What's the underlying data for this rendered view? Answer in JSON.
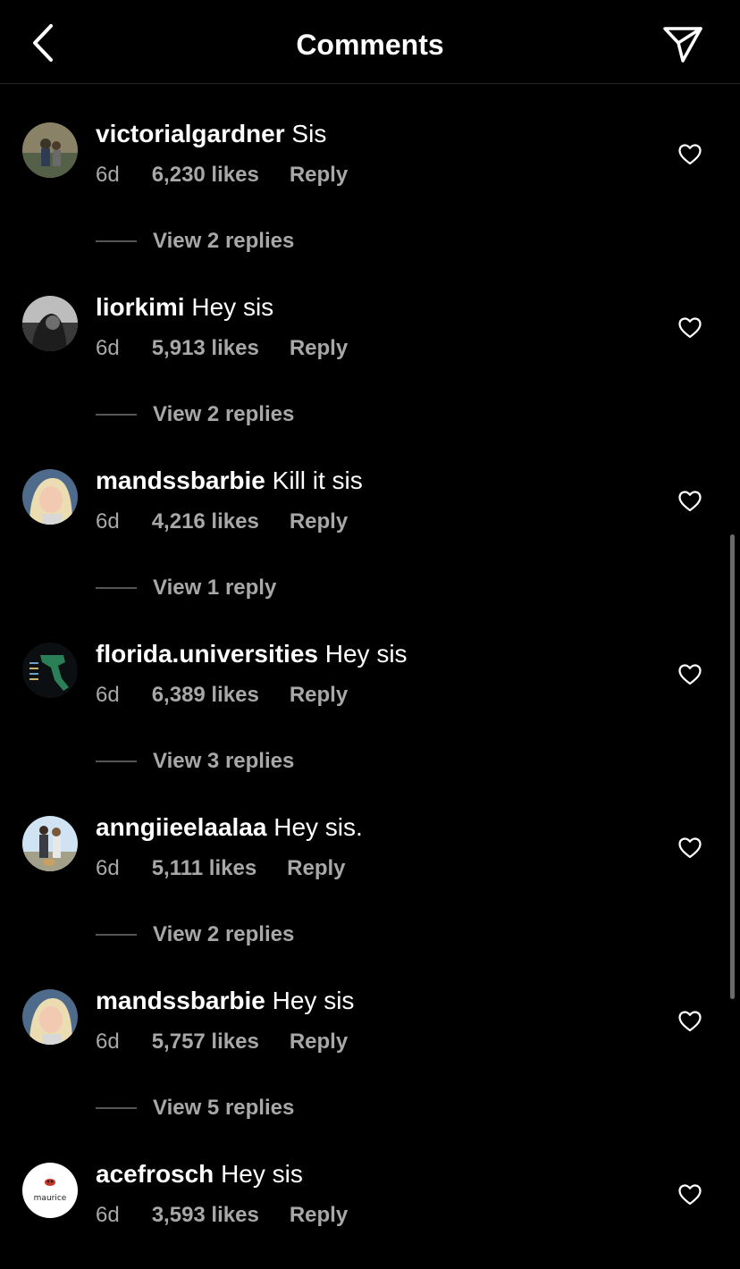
{
  "header": {
    "title": "Comments",
    "back_icon": "chevron-left-icon",
    "share_icon": "paper-plane-icon"
  },
  "comments": [
    {
      "username": "victorialgardner",
      "text": "Sis",
      "time": "6d",
      "likes": "6,230 likes",
      "reply": "Reply",
      "view_replies": "View 2 replies",
      "avatar_colors": [
        "#6e6a52",
        "#3f4a3a"
      ]
    },
    {
      "username": "liorkimi",
      "text": "Hey sis",
      "time": "6d",
      "likes": "5,913 likes",
      "reply": "Reply",
      "view_replies": "View 2 replies",
      "avatar_colors": [
        "#d8d8d8",
        "#2a2a2a"
      ]
    },
    {
      "username": "mandssbarbie",
      "text": "Kill it sis",
      "time": "6d",
      "likes": "4,216 likes",
      "reply": "Reply",
      "view_replies": "View 1 reply",
      "avatar_colors": [
        "#e9d9b8",
        "#5b6f86"
      ]
    },
    {
      "username": "florida.universities",
      "text": "Hey sis",
      "time": "6d",
      "likes": "6,389 likes",
      "reply": "Reply",
      "view_replies": "View 3 replies",
      "avatar_colors": [
        "#0b0f12",
        "#2a7f56"
      ]
    },
    {
      "username": "anngiieelaalaa",
      "text": "Hey sis.",
      "time": "6d",
      "likes": "5,111 likes",
      "reply": "Reply",
      "view_replies": "View 2 replies",
      "avatar_colors": [
        "#cfe3f2",
        "#3b3b44"
      ]
    },
    {
      "username": "mandssbarbie",
      "text": "Hey sis",
      "time": "6d",
      "likes": "5,757 likes",
      "reply": "Reply",
      "view_replies": "View 5 replies",
      "avatar_colors": [
        "#e9d9b8",
        "#5b6f86"
      ]
    },
    {
      "username": "acefrosch",
      "text": "Hey sis",
      "time": "6d",
      "likes": "3,593 likes",
      "reply": "Reply",
      "view_replies": "",
      "avatar_colors": [
        "#ffffff",
        "#c0392b"
      ],
      "avatar_text": "maurice"
    }
  ]
}
